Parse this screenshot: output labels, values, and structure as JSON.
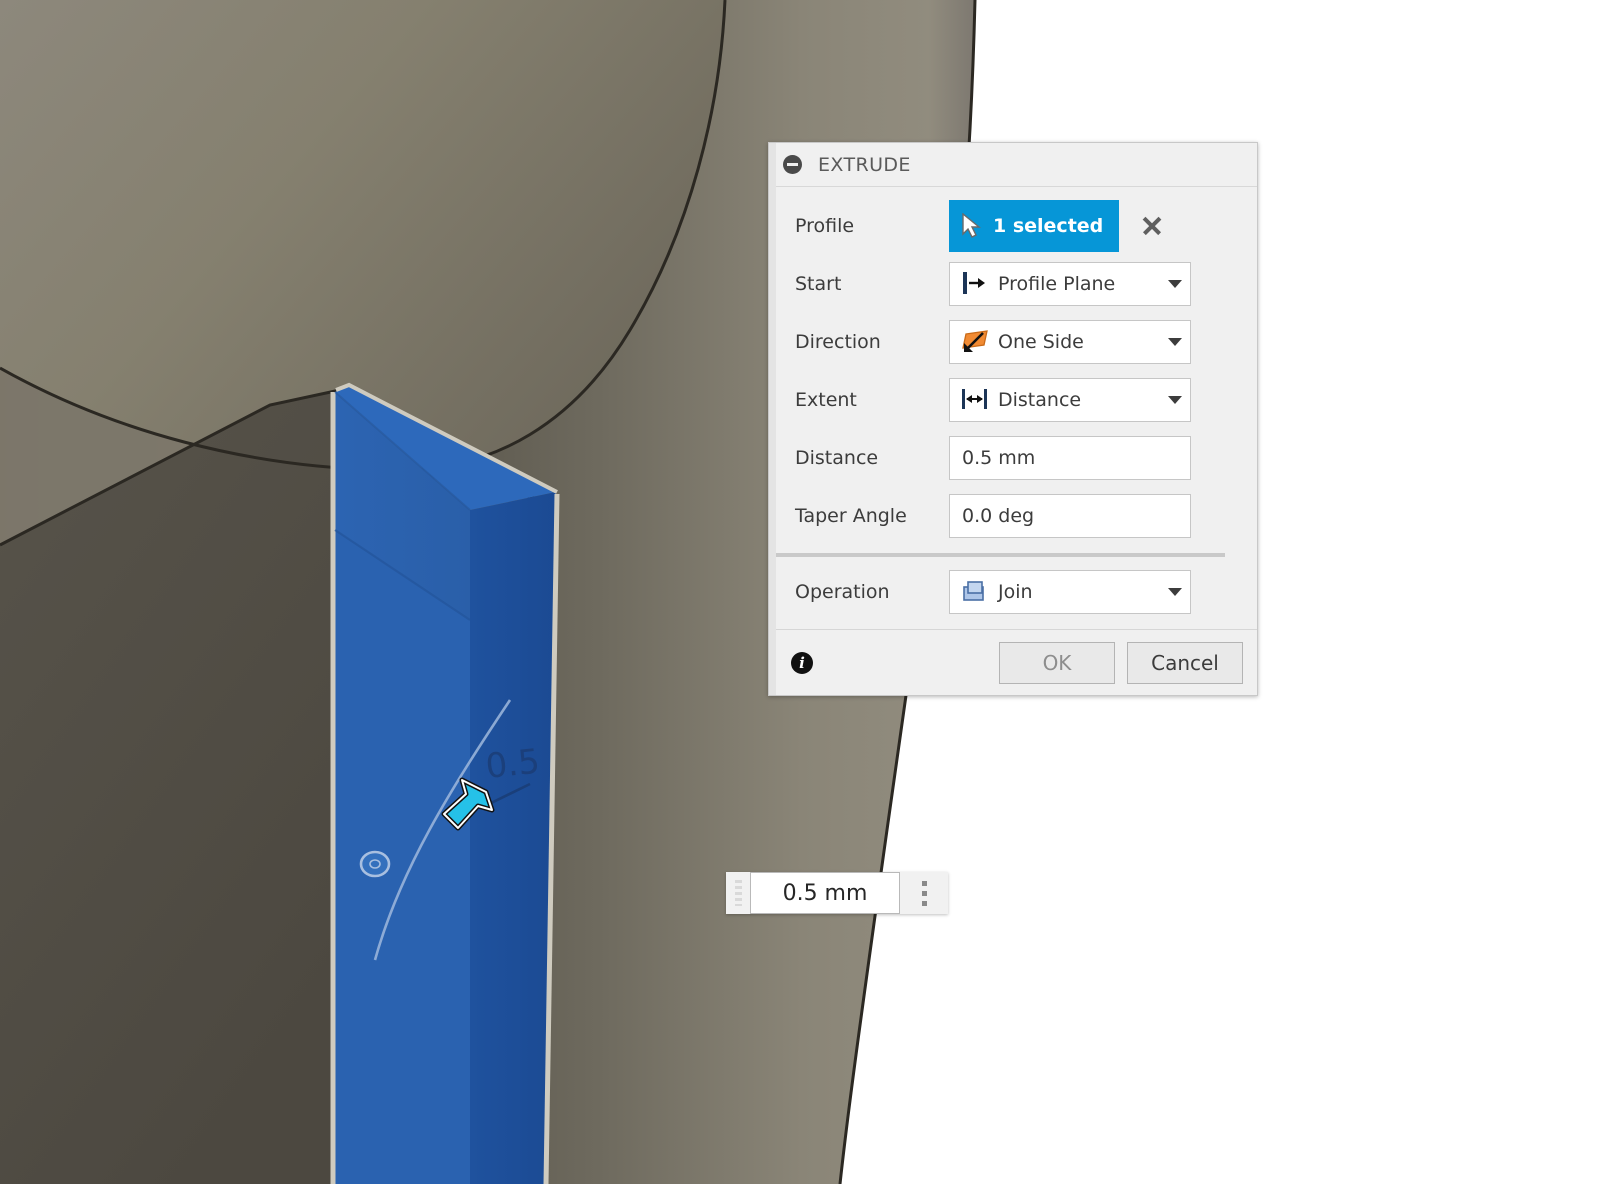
{
  "app": {
    "viewport_background": "#ffffff",
    "model_color_light": "#7a7569",
    "model_color_mid": "#6d675c",
    "model_color_dark": "#4e4a42",
    "highlight_blue_face": "#2a62b0",
    "highlight_blue_side": "#1c4f9c",
    "highlight_blue_top": "#2f6bbd"
  },
  "dialog": {
    "title": "EXTRUDE",
    "collapse_icon": "collapse-minus-icon",
    "rows": {
      "profile": {
        "label": "Profile",
        "selection_text": "1 selected",
        "selection_icon": "cursor-arrow-icon",
        "clear_icon": "clear-selection-x-icon"
      },
      "start": {
        "label": "Start",
        "value": "Profile Plane",
        "icon": "profile-plane-icon"
      },
      "direction": {
        "label": "Direction",
        "value": "One Side",
        "icon": "one-side-icon"
      },
      "extent": {
        "label": "Extent",
        "value": "Distance",
        "icon": "distance-extent-icon"
      },
      "distance": {
        "label": "Distance",
        "value": "0.5 mm"
      },
      "taper_angle": {
        "label": "Taper Angle",
        "value": "0.0 deg"
      },
      "operation": {
        "label": "Operation",
        "value": "Join",
        "icon": "join-operation-icon"
      }
    },
    "footer": {
      "info_icon": "info-icon",
      "info_glyph": "i",
      "ok_label": "OK",
      "cancel_label": "Cancel"
    }
  },
  "manipulator": {
    "value": "0.5 mm",
    "dimension_label": "0.5",
    "drag_grip_icon": "drag-grip-icon",
    "options_dots_icon": "options-dots-icon",
    "cursor_icon": "drag-arrow-cursor-icon"
  }
}
